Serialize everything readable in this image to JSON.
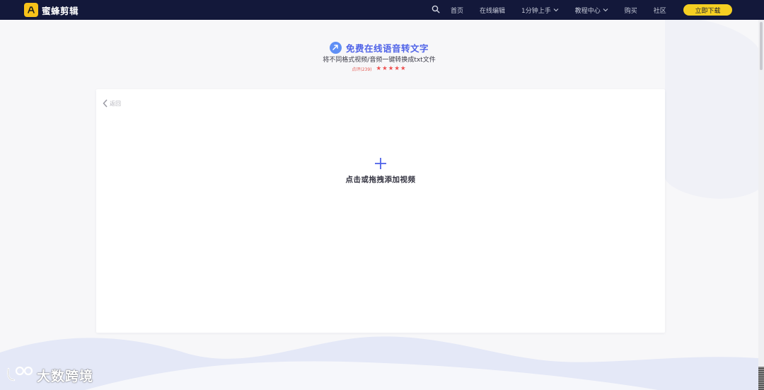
{
  "header": {
    "brand_name": "蜜蜂剪辑",
    "nav": {
      "search_icon": "search-icon",
      "items": [
        {
          "label": "首页"
        },
        {
          "label": "在线编辑"
        },
        {
          "label": "1分钟上手"
        },
        {
          "label": "教程中心"
        },
        {
          "label": "购买"
        },
        {
          "label": "社区"
        }
      ],
      "cta_label": "立即下载"
    }
  },
  "hero": {
    "title": "免费在线语音转文字",
    "subtitle": "将不同格式视频/音频一键转换成txt文件",
    "rating_text": "点评(239)",
    "stars": 5
  },
  "card": {
    "back_label": "返回",
    "upload_label": "点击或拖拽添加视频"
  },
  "watermark": {
    "text": "大数跨境"
  },
  "colors": {
    "header_bg": "#13183a",
    "brand_yellow": "#f7c21a",
    "cta_yellow": "#f5cf22",
    "accent_blue": "#4f63e8",
    "star_red": "#ee4e4e"
  }
}
